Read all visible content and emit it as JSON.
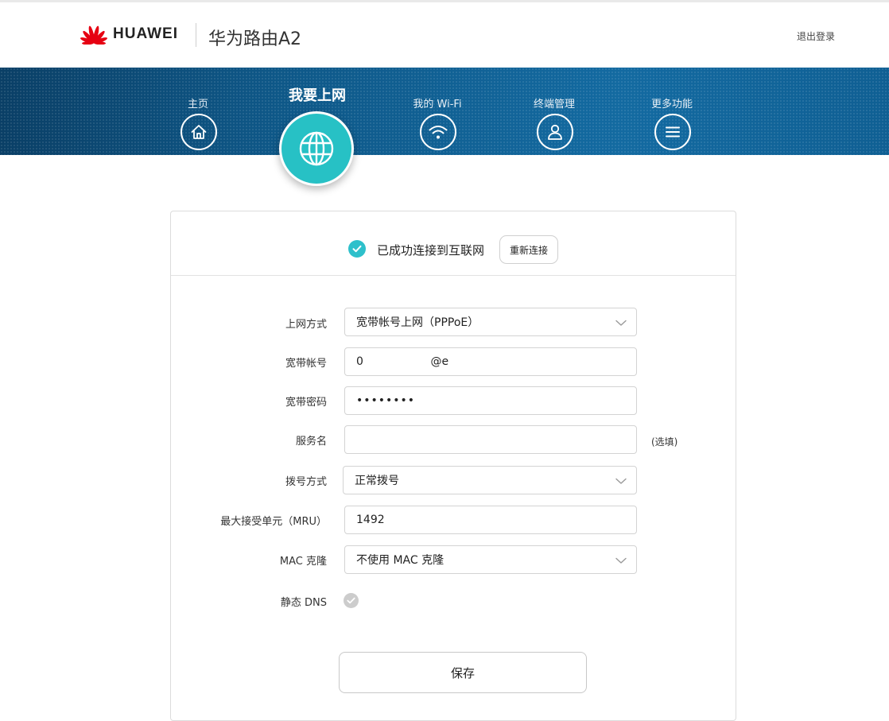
{
  "header": {
    "brand": "HUAWEI",
    "product": "华为路由A2",
    "logout": "退出登录"
  },
  "nav": {
    "items": [
      {
        "label": "主页",
        "icon": "home-icon",
        "active": false
      },
      {
        "label": "我要上网",
        "icon": "globe-icon",
        "active": true
      },
      {
        "label": "我的 Wi-Fi",
        "icon": "wifi-icon",
        "active": false
      },
      {
        "label": "终端管理",
        "icon": "user-icon",
        "active": false
      },
      {
        "label": "更多功能",
        "icon": "menu-icon",
        "active": false
      }
    ]
  },
  "status": {
    "text": "已成功连接到互联网",
    "reconnect": "重新连接"
  },
  "form": {
    "connection_type": {
      "label": "上网方式",
      "value": "宽带帐号上网（PPPoE）"
    },
    "account": {
      "label": "宽带帐号",
      "value": "0                   @e"
    },
    "password": {
      "label": "宽带密码",
      "value": "••••••••"
    },
    "service_name": {
      "label": "服务名",
      "value": "",
      "hint": "(选填)"
    },
    "dial_mode": {
      "label": "拨号方式",
      "value": "正常拨号"
    },
    "mru": {
      "label": "最大接受单元（MRU）",
      "value": "1492"
    },
    "mac_clone": {
      "label": "MAC 克隆",
      "value": "不使用 MAC 克隆"
    },
    "static_dns": {
      "label": "静态 DNS",
      "enabled": false
    }
  },
  "actions": {
    "save": "保存"
  },
  "colors": {
    "accent": "#27c1c5",
    "nav_band": "#0f5d8c",
    "brand_red": "#e60012",
    "toggle_off": "#cccccc"
  }
}
